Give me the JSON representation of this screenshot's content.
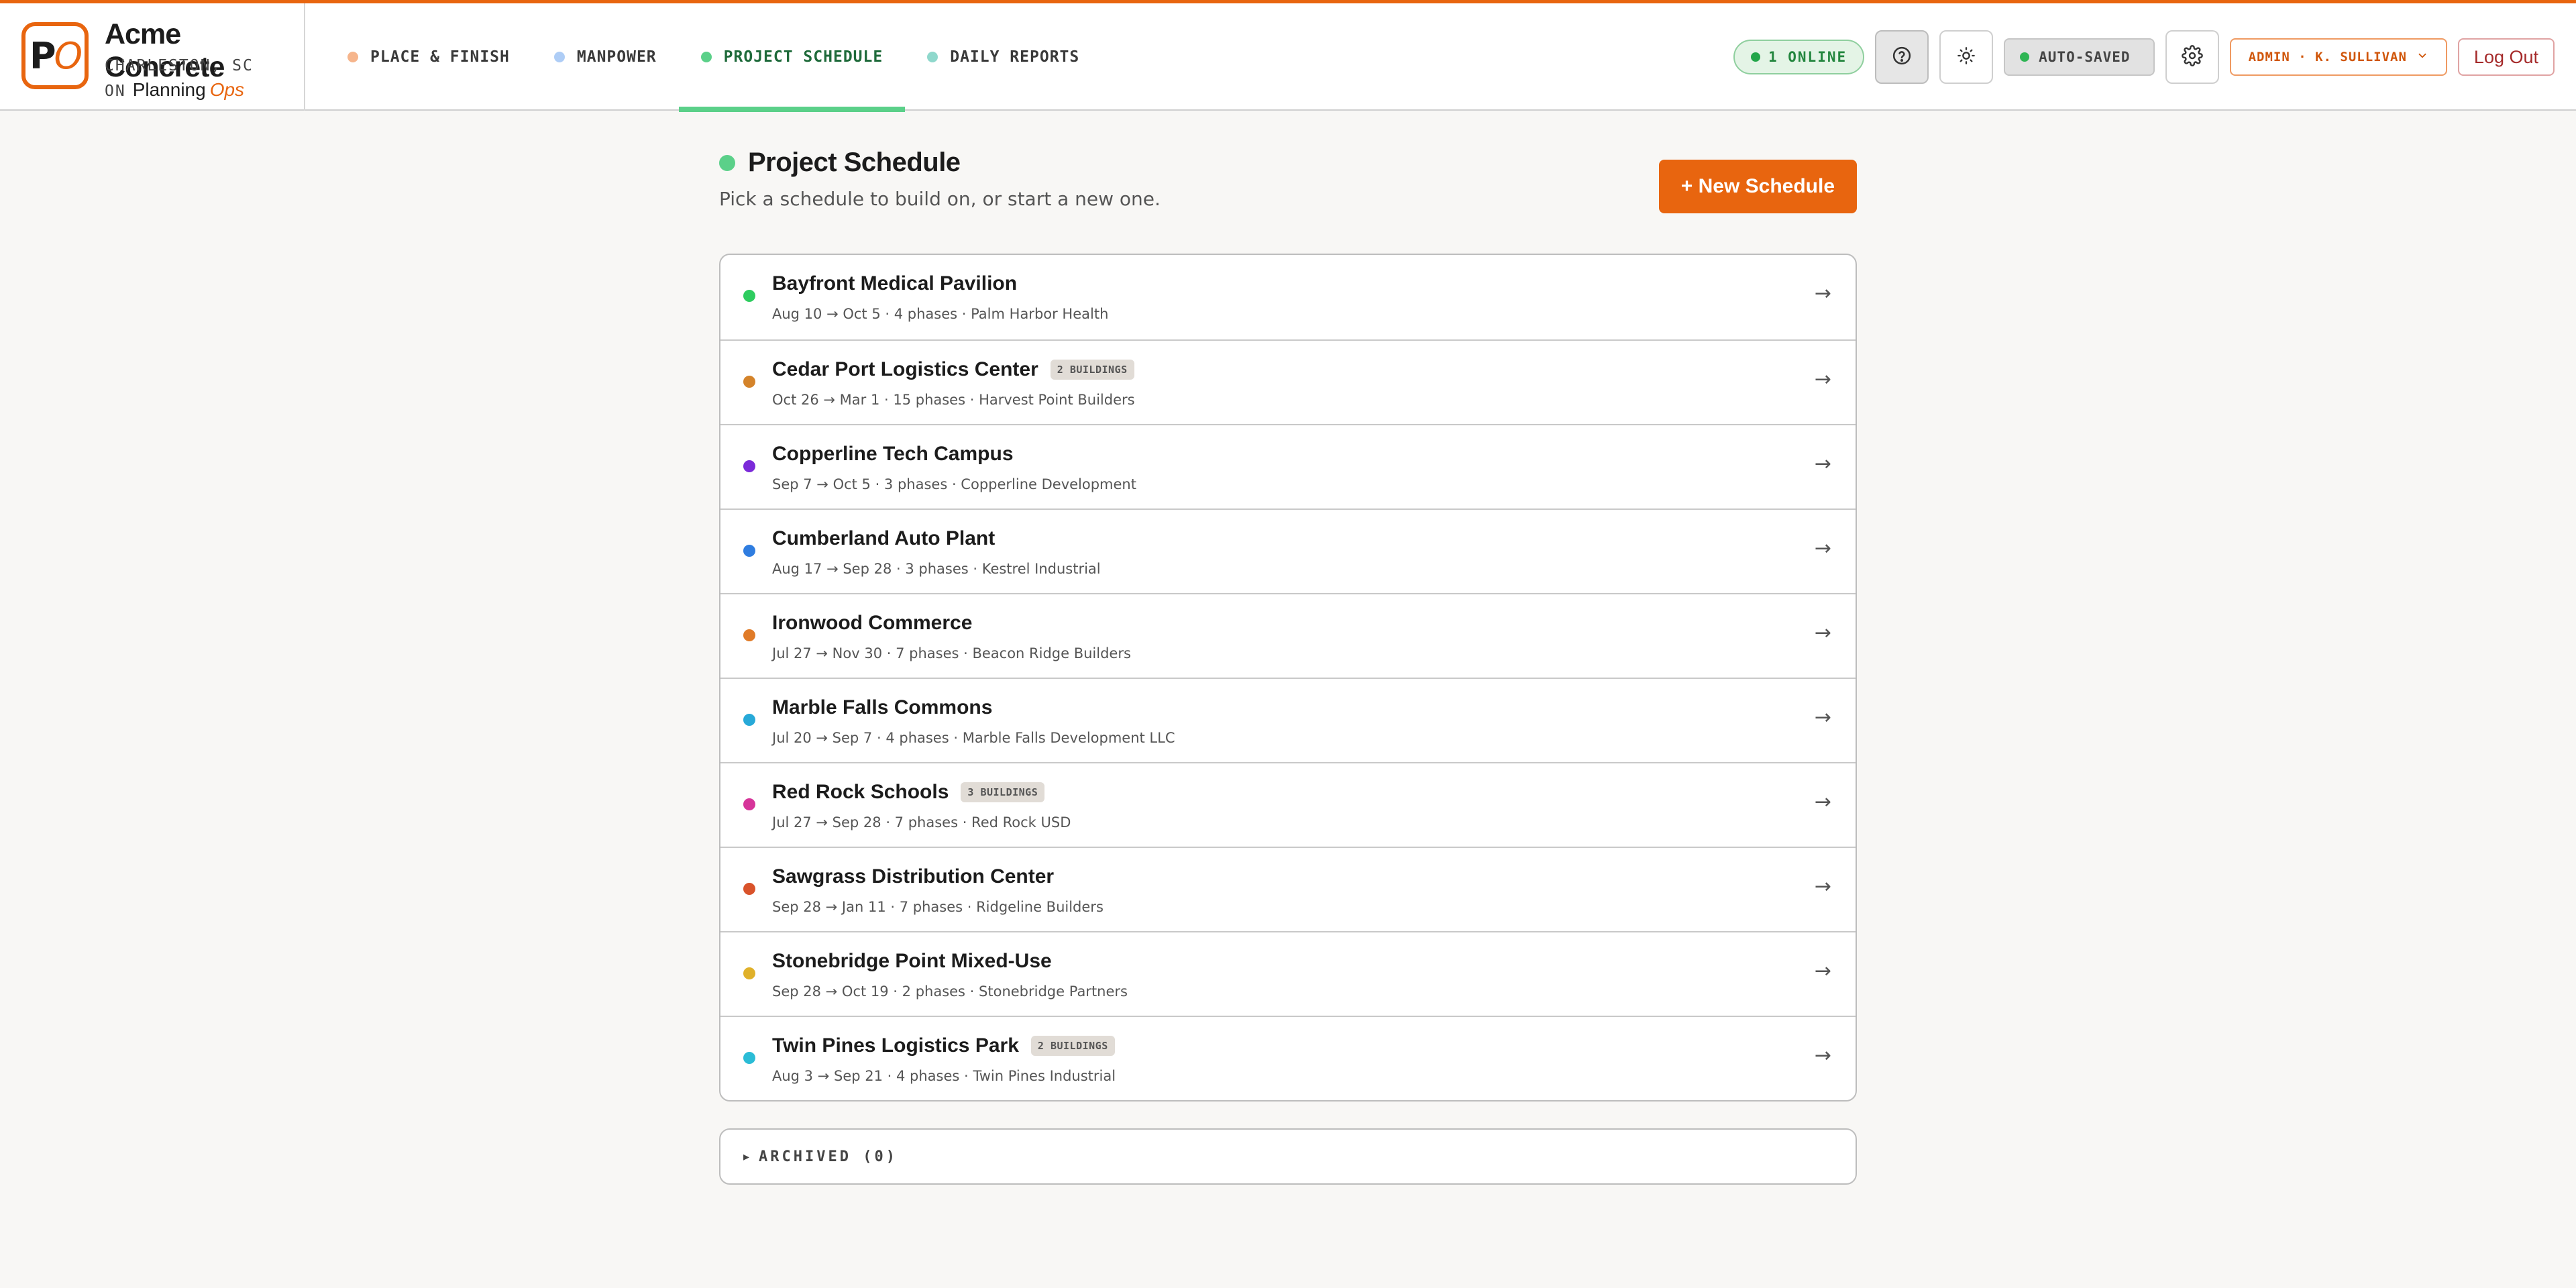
{
  "brand": {
    "logo_p": "P",
    "logo_o": "O",
    "name": "Acme Concrete",
    "location": "CHARLESTON, SC",
    "on": "ON",
    "planning": "Planning",
    "ops": "Ops",
    "accent": "#e8650f"
  },
  "nav": {
    "tabs": [
      {
        "label": "PLACE & FINISH",
        "dot": "#f6b58c"
      },
      {
        "label": "MANPOWER",
        "dot": "#aecdf6"
      },
      {
        "label": "PROJECT SCHEDULE",
        "dot": "#5bd089",
        "active": true
      },
      {
        "label": "DAILY REPORTS",
        "dot": "#8fd8cc"
      }
    ]
  },
  "header": {
    "online": "1 ONLINE",
    "help_icon": "help-icon",
    "theme_icon": "sun-icon",
    "autosaved": "AUTO-SAVED",
    "settings_icon": "gear-icon",
    "user": "ADMIN · K. SULLIVAN",
    "logout": "Log Out"
  },
  "page": {
    "title": "Project Schedule",
    "subtitle": "Pick a schedule to build on, or start a new one.",
    "new_button": "+ New Schedule"
  },
  "schedules": [
    {
      "name": "Bayfront Medical Pavilion",
      "badge": "",
      "meta": "Aug 10 → Oct 5 · 4 phases · Palm Harbor Health",
      "color": "#2ecc5f"
    },
    {
      "name": "Cedar Port Logistics Center",
      "badge": "2 BUILDINGS",
      "meta": "Oct 26 → Mar 1 · 15 phases · Harvest Point Builders",
      "color": "#d4832a"
    },
    {
      "name": "Copperline Tech Campus",
      "badge": "",
      "meta": "Sep 7 → Oct 5 · 3 phases · Copperline Development",
      "color": "#7b2ad9"
    },
    {
      "name": "Cumberland Auto Plant",
      "badge": "",
      "meta": "Aug 17 → Sep 28 · 3 phases · Kestrel Industrial",
      "color": "#2f7de0"
    },
    {
      "name": "Ironwood Commerce",
      "badge": "",
      "meta": "Jul 27 → Nov 30 · 7 phases · Beacon Ridge Builders",
      "color": "#e07b28"
    },
    {
      "name": "Marble Falls Commons",
      "badge": "",
      "meta": "Jul 20 → Sep 7 · 4 phases · Marble Falls Development LLC",
      "color": "#27a9d8"
    },
    {
      "name": "Red Rock Schools",
      "badge": "3 BUILDINGS",
      "meta": "Jul 27 → Sep 28 · 7 phases · Red Rock USD",
      "color": "#d6359a"
    },
    {
      "name": "Sawgrass Distribution Center",
      "badge": "",
      "meta": "Sep 28 → Jan 11 · 7 phases · Ridgeline Builders",
      "color": "#d9532b"
    },
    {
      "name": "Stonebridge Point Mixed-Use",
      "badge": "",
      "meta": "Sep 28 → Oct 19 · 2 phases · Stonebridge Partners",
      "color": "#e0b12a"
    },
    {
      "name": "Twin Pines Logistics Park",
      "badge": "2 BUILDINGS",
      "meta": "Aug 3 → Sep 21 · 4 phases · Twin Pines Industrial",
      "color": "#2bbcd6"
    }
  ],
  "row_arrow": "→",
  "archived": {
    "label": "ARCHIVED (0)",
    "toggle": "▸"
  }
}
